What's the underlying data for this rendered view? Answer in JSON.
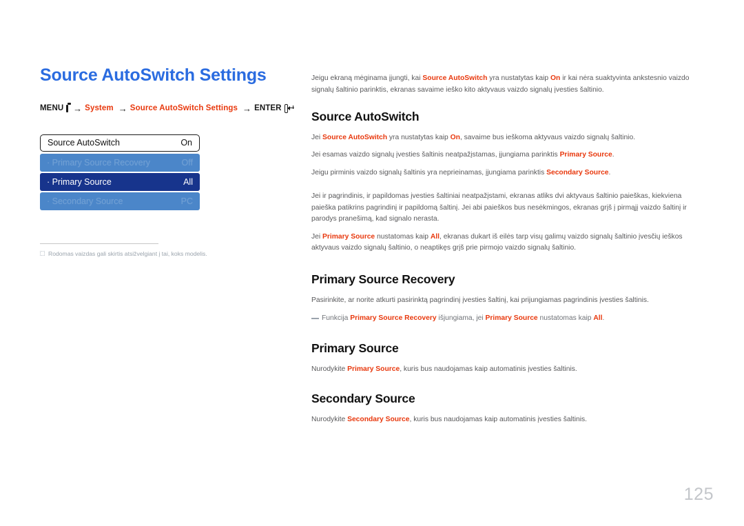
{
  "page": {
    "title": "Source AutoSwitch Settings",
    "number": "125"
  },
  "breadcrumb": {
    "menu_label": "MENU",
    "menu_icon": "menu-remote-icon",
    "arrow": "→",
    "step1": "System",
    "step2": "Source AutoSwitch Settings",
    "enter_label": "ENTER",
    "enter_icon": "enter-key-icon"
  },
  "osd_menu": {
    "rows": [
      {
        "label": "Source AutoSwitch",
        "value": "On",
        "state": "header"
      },
      {
        "label": "· Primary Source Recovery",
        "value": "Off",
        "state": "disabled"
      },
      {
        "label": "· Primary Source",
        "value": "All",
        "state": "selected"
      },
      {
        "label": "· Secondary Source",
        "value": "PC",
        "state": "disabled"
      }
    ]
  },
  "footnote": {
    "icon": "dotted-square-note-icon",
    "text": "Rodomas vaizdas gali skirtis atsižvelgiant į tai, koks modelis."
  },
  "intro": {
    "part1": "Jeigu ekraną mėginama įjungti, kai ",
    "hl1": "Source AutoSwitch",
    "part2": " yra nustatytas kaip ",
    "hl2": "On",
    "part3": " ir kai nėra suaktyvinta ankstesnio vaizdo signalų šaltinio parinktis, ekranas savaime ieško kito aktyvaus vaizdo signalų įvesties šaltinio."
  },
  "sections": [
    {
      "title": "Source AutoSwitch",
      "paragraphs": [
        {
          "p1": "Jei ",
          "h1": "Source AutoSwitch",
          "p2": " yra nustatytas kaip ",
          "h2": "On",
          "p3": ", savaime bus ieškoma aktyvaus vaizdo signalų šaltinio."
        },
        {
          "p1": "Jei esamas vaizdo signalų įvesties šaltinis neatpažįstamas, įjungiama parinktis ",
          "h1": "Primary Source",
          "p2": "."
        },
        {
          "p1": "Jeigu pirminis vaizdo signalų šaltinis yra neprieinamas, įjungiama parinktis ",
          "h1": "Secondary Source",
          "p2": "."
        },
        {
          "p1": "Jei ir pagrindinis, ir papildomas įvesties šaltiniai neatpažįstami, ekranas atliks dvi aktyvaus šaltinio paieškas, kiekviena paieška patikrins pagrindinį ir papildomą šaltinį. Jei abi paieškos bus nesėkmingos, ekranas grįš į pirmąjį vaizdo šaltinį ir parodys pranešimą, kad signalo nerasta."
        },
        {
          "p1": "Jei ",
          "h1": "Primary Source",
          "p2": " nustatomas kaip ",
          "h2": "All",
          "p3": ", ekranas dukart iš eilės tarp visų galimų vaizdo signalų šaltinio įvesčių ieškos aktyvaus vaizdo signalų šaltinio, o neaptikęs grįš prie pirmojo vaizdo signalų šaltinio."
        }
      ]
    },
    {
      "title": "Primary Source Recovery",
      "paragraphs": [
        {
          "p1": "Pasirinkite, ar norite atkurti pasirinktą pagrindinį įvesties šaltinį, kai prijungiamas pagrindinis įvesties šaltinis."
        }
      ],
      "note": {
        "icon": "dash-note-icon",
        "p1": "Funkcija ",
        "h1": "Primary Source Recovery",
        "p2": " išjungiama, jei ",
        "h2": "Primary Source",
        "p3": " nustatomas kaip ",
        "h3": "All",
        "p4": "."
      }
    },
    {
      "title": "Primary Source",
      "paragraphs": [
        {
          "p1": "Nurodykite ",
          "h1": "Primary Source",
          "p2": ", kuris bus naudojamas kaip automatinis įvesties šaltinis."
        }
      ]
    },
    {
      "title": "Secondary Source",
      "paragraphs": [
        {
          "p1": "Nurodykite ",
          "h1": "Secondary Source",
          "p2": ", kuris bus naudojamas kaip automatinis įvesties šaltinis."
        }
      ]
    }
  ],
  "colors": {
    "title_blue": "#2b6ce0",
    "highlight_red": "#e8380d",
    "osd_selected": "#17348c",
    "osd_disabled": "#4b86c9",
    "body_text": "#58585a",
    "page_number": "#c3c6ca"
  }
}
